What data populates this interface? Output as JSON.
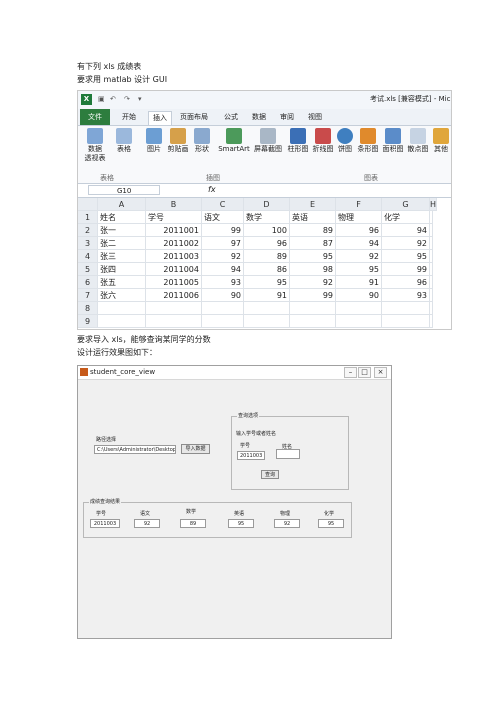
{
  "intro": [
    "有下列 xls 成绩表",
    "要求用 matlab 设计 GUI"
  ],
  "excel": {
    "title": "考试.xls [兼容模式] - Mic",
    "tabs": [
      "文件",
      "开始",
      "插入",
      "页面布局",
      "公式",
      "数据",
      "审阅",
      "视图"
    ],
    "ribbon": [
      {
        "label": "数据\n透视表",
        "icon": "pivot-table-icon"
      },
      {
        "label": "表格",
        "icon": "table-icon"
      },
      {
        "label": "图片",
        "icon": "picture-icon"
      },
      {
        "label": "剪贴画",
        "icon": "clipart-icon"
      },
      {
        "label": "形状",
        "icon": "shapes-icon"
      },
      {
        "label": "SmartArt",
        "icon": "smartart-icon"
      },
      {
        "label": "屏幕截图",
        "icon": "screenshot-icon"
      },
      {
        "label": "柱形图",
        "icon": "column-chart-icon"
      },
      {
        "label": "折线图",
        "icon": "line-chart-icon"
      },
      {
        "label": "饼图",
        "icon": "pie-chart-icon"
      },
      {
        "label": "条形图",
        "icon": "bar-chart-icon"
      },
      {
        "label": "面积图",
        "icon": "area-chart-icon"
      },
      {
        "label": "散点图",
        "icon": "scatter-chart-icon"
      },
      {
        "label": "其他",
        "icon": "other-chart-icon"
      }
    ],
    "groups": [
      "表格",
      "插图",
      "图表"
    ],
    "namebox": "G10",
    "fx": "fx",
    "columns": [
      "A",
      "B",
      "C",
      "D",
      "E",
      "F",
      "G",
      "H"
    ],
    "row_numbers": [
      "1",
      "2",
      "3",
      "4",
      "5",
      "6",
      "7",
      "8",
      "9"
    ],
    "header": [
      "姓名",
      "学号",
      "语文",
      "数学",
      "英语",
      "物理",
      "化学"
    ],
    "rows": [
      [
        "张一",
        "2011001",
        "99",
        "100",
        "89",
        "96",
        "94"
      ],
      [
        "张二",
        "2011002",
        "97",
        "96",
        "87",
        "94",
        "92"
      ],
      [
        "张三",
        "2011003",
        "92",
        "89",
        "95",
        "92",
        "95"
      ],
      [
        "张四",
        "2011004",
        "94",
        "86",
        "98",
        "95",
        "99"
      ],
      [
        "张五",
        "2011005",
        "93",
        "95",
        "92",
        "91",
        "96"
      ],
      [
        "张六",
        "2011006",
        "90",
        "91",
        "99",
        "90",
        "93"
      ]
    ]
  },
  "mid_text": [
    "要求导入 xls，能够查询某同学的分数",
    "设计运行效果图如下："
  ],
  "gui": {
    "title": "student_core_view",
    "path_label": "路径选择",
    "path_value": "C:\\Users\\Administrator\\Desktop\\考试.xls",
    "import_button": "导入数据",
    "query_panel_title": "查询选项",
    "query_hint": "输入学号或者姓名",
    "id_label": "学号",
    "name_label": "姓名",
    "id_value": "2011003",
    "name_value": "",
    "query_button": "查询",
    "result_panel_title": "成绩查询结果",
    "result_labels": [
      "学号",
      "语文",
      "数学",
      "英语",
      "物理",
      "化学"
    ],
    "result_values": [
      "2011003",
      "92",
      "89",
      "95",
      "92",
      "95"
    ]
  }
}
